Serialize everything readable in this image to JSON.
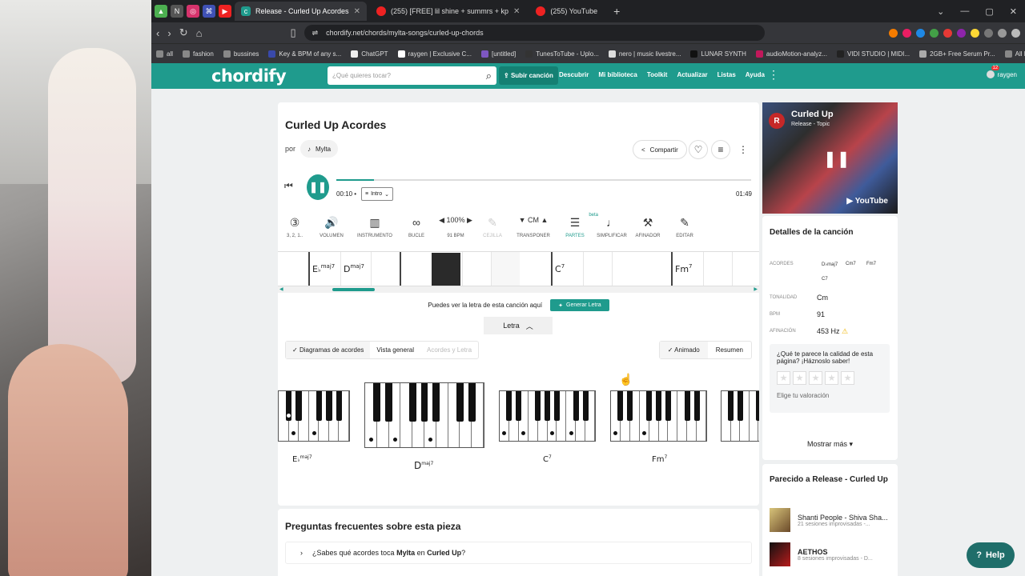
{
  "browser": {
    "tabs": [
      {
        "label": "Release - Curled Up Acordes",
        "active": true
      },
      {
        "label": "(255) [FREE] lil shine + summrs + kp",
        "active": false
      },
      {
        "label": "(255) YouTube",
        "active": false
      }
    ],
    "new_tab": "+",
    "url": "chordify.net/chords/mylta-songs/curled-up-chords",
    "bookmarks": [
      "all",
      "fashion",
      "bussines",
      "Key & BPM of any s...",
      "ChatGPT",
      "raygen | Exclusive C...",
      "[untitled]",
      "TunesToTube - Uplo...",
      "nero | music livestre...",
      "LUNAR SYNTH",
      "audioMotion-analyz...",
      "VIDI STUDIO | MIDI...",
      "2GB+ Free Serum Pr...",
      "All Bookmarks"
    ]
  },
  "site": {
    "logo": "chordify",
    "search_placeholder": "¿Qué quieres tocar?",
    "upload": "Subir canción",
    "nav": [
      "Descubrir",
      "Mi biblioteca",
      "Toolkit",
      "Actualizar",
      "Listas",
      "Ayuda"
    ],
    "user": "raygen",
    "user_badge": "12"
  },
  "song": {
    "title": "Curled Up Acordes",
    "by": "por",
    "artist": "Mylta",
    "share": "Compartir",
    "current_time": "00:10",
    "section": "Intro",
    "total_time": "01:49",
    "progress": 0.09
  },
  "tools": [
    {
      "label": "3, 2, 1..",
      "icon": "countdown-icon",
      "glyph": "③"
    },
    {
      "label": "Volumen",
      "icon": "volume-icon",
      "glyph": "🔊"
    },
    {
      "label": "Instrumento",
      "icon": "piano-icon",
      "glyph": "▥"
    },
    {
      "label": "Bucle",
      "icon": "loop-icon",
      "glyph": "∞"
    },
    {
      "label": "91 BPM",
      "top": "100%",
      "icon": "tempo-icon",
      "glyph": "◀ ▶"
    },
    {
      "label": "Cejilla",
      "icon": "capo-icon",
      "glyph": "✎"
    },
    {
      "label": "Transponer",
      "top": "Cm",
      "icon": "transpose-icon",
      "glyph": "▼ ▲"
    },
    {
      "label": "Partes",
      "beta": "beta",
      "icon": "parts-icon",
      "glyph": "☰"
    },
    {
      "label": "Simplificar",
      "icon": "note-icon",
      "glyph": "♩"
    },
    {
      "label": "Afinador",
      "icon": "tuner-icon",
      "glyph": "⚒"
    },
    {
      "label": "Editar",
      "icon": "pencil-icon",
      "glyph": "✎"
    }
  ],
  "timeline": [
    {
      "root": "E",
      "flat": "♭",
      "ext": "maj7"
    },
    {
      "root": "D",
      "flat": "",
      "ext": "maj7"
    },
    {
      "root": "C",
      "flat": "",
      "ext": "7"
    },
    {
      "root": "Fm",
      "flat": "",
      "ext": "7"
    }
  ],
  "lyrics": {
    "notice": "Puedes ver la letra de esta canción aquí",
    "generate": "Generar Letra",
    "toggle": "Letra"
  },
  "views": {
    "tabs": [
      "Diagramas de acordes",
      "Vista general",
      "Acordes y Letra"
    ],
    "animated": "Animado",
    "summary": "Resumen"
  },
  "chord_diagrams": [
    {
      "root": "E",
      "flat": "♭",
      "ext": "maj7"
    },
    {
      "root": "D",
      "flat": "",
      "ext": "maj7"
    },
    {
      "root": "C",
      "flat": "",
      "ext": "7"
    },
    {
      "root": "Fm",
      "flat": "",
      "ext": "7"
    }
  ],
  "faq": {
    "title": "Preguntas frecuentes sobre esta pieza",
    "q1_pre": "¿Sabes qué acordes toca",
    "q1_artist": "Mylta",
    "q1_mid": "en",
    "q1_song": "Curled Up",
    "q1_end": "?"
  },
  "video": {
    "avatar": "R",
    "title": "Curled Up",
    "sub": "Release - Topic",
    "brand": "YouTube"
  },
  "details": {
    "title": "Detalles de la canción",
    "chords_label": "Acordes",
    "chords": [
      "D♭maj7",
      "Cm7",
      "Fm7",
      "C7"
    ],
    "key_label": "Tonalidad",
    "key": "Cm",
    "bpm_label": "BPM",
    "bpm": "91",
    "tuning_label": "Afinación",
    "tuning": "453 Hz",
    "rate_q": "¿Qué te parece la calidad de esta página? ¡Háznoslo saber!",
    "rate_cta": "Elige tu valoración",
    "more": "Mostrar más"
  },
  "similar": {
    "title": "Parecido a Release - Curled Up",
    "items": [
      {
        "name": "Shanti People - Shiva Sha...",
        "sub": "21 sesiones improvisadas -..."
      },
      {
        "name": "AETHOS",
        "sub": "8 sesiones improvisadas - D..."
      }
    ]
  },
  "help": "Help",
  "colors": {
    "brand": "#1f9b8d",
    "brand_dark": "#148073"
  }
}
